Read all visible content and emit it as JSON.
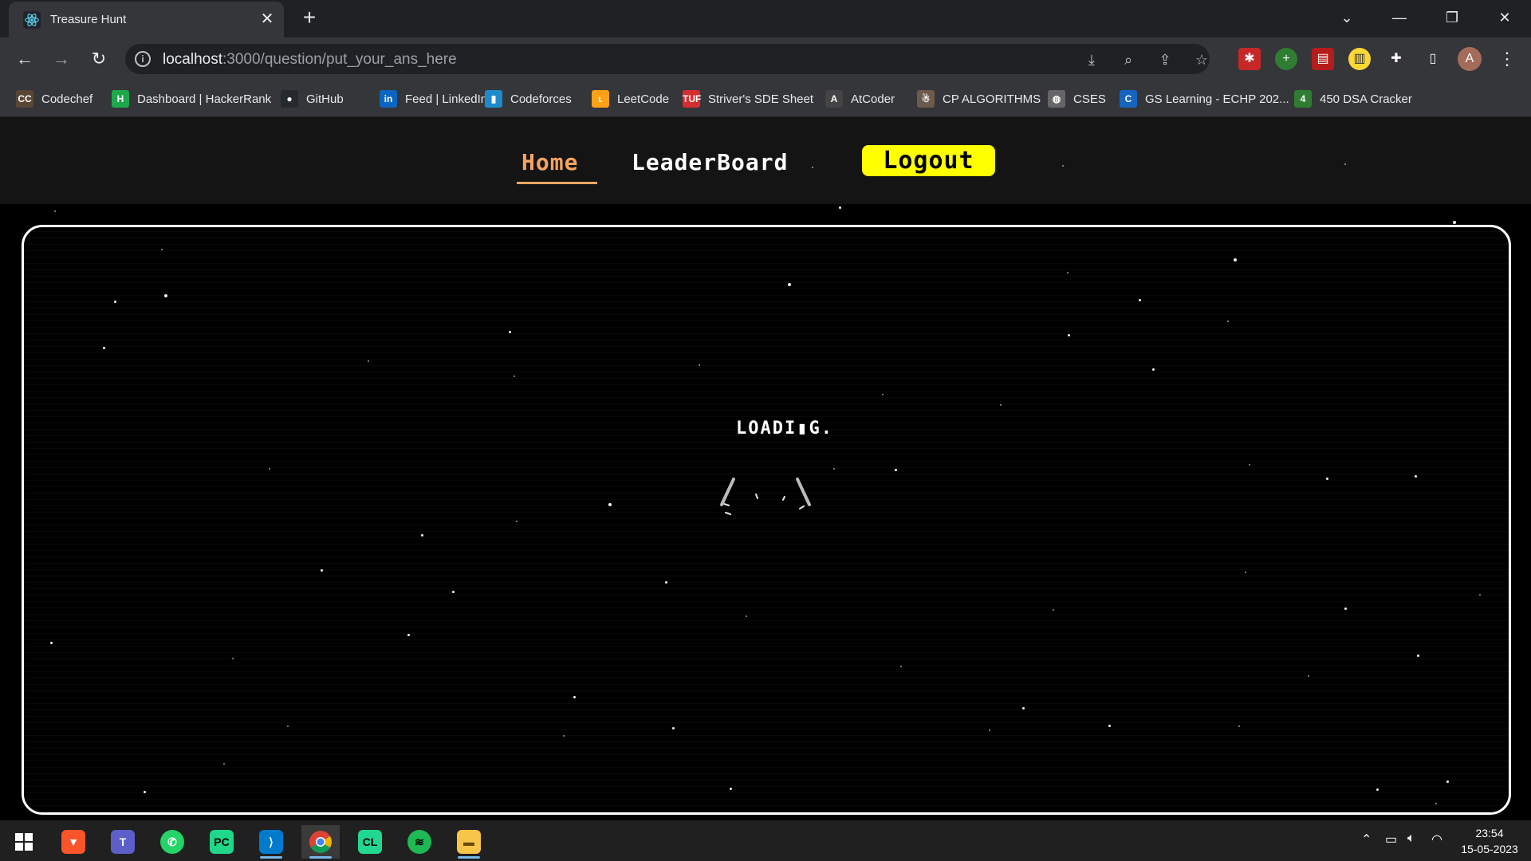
{
  "browser": {
    "tab_title": "Treasure Hunt",
    "tab_close": "✕",
    "new_tab": "+",
    "url_host": "localhost",
    "url_path": ":3000/question/put_your_ans_here",
    "bookmarks": [
      {
        "label": "Codechef",
        "icon": "CC",
        "color": "#5b4636"
      },
      {
        "label": "Dashboard | HackerRank",
        "icon": "H",
        "color": "#1ba94c"
      },
      {
        "label": "GitHub",
        "icon": "●",
        "color": "#24292e"
      },
      {
        "label": "Feed | LinkedIn",
        "icon": "in",
        "color": "#0a66c2"
      },
      {
        "label": "Codeforces",
        "icon": "▮",
        "color": "#1f8acb"
      },
      {
        "label": "LeetCode",
        "icon": "ʟ",
        "color": "#ffa116"
      },
      {
        "label": "Striver's SDE Sheet",
        "icon": "TUF",
        "color": "#d32f2f"
      },
      {
        "label": "AtCoder",
        "icon": "A",
        "color": "#444444"
      },
      {
        "label": "CP ALGORITHMS",
        "icon": "☃",
        "color": "#6d5a4b"
      },
      {
        "label": "CSES",
        "icon": "◍",
        "color": "#666666"
      },
      {
        "label": "GS Learning - ECHP 202...",
        "icon": "C",
        "color": "#1565c0"
      },
      {
        "label": "450 DSA Cracker",
        "icon": "4",
        "color": "#2e7d32"
      }
    ]
  },
  "page": {
    "nav": {
      "home": "Home",
      "leaderboard": "LeaderBoard",
      "logout": "Logout"
    },
    "loading_text": "LOADI▮G."
  },
  "taskbar": {
    "time": "23:54",
    "date": "15-05-2023"
  },
  "colors": {
    "accent_home": "#f4a460",
    "logout_bg": "#ffff00"
  }
}
